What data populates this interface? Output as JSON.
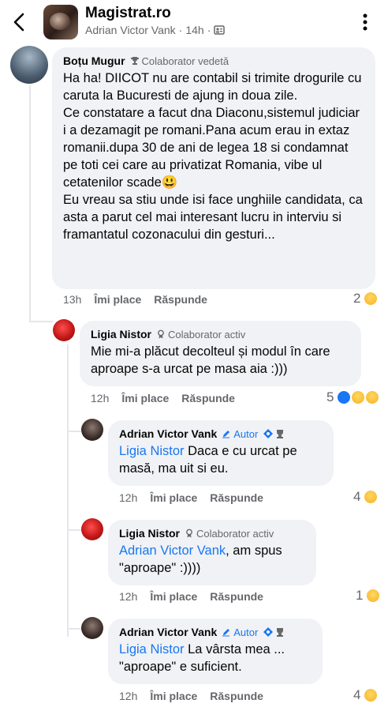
{
  "header": {
    "page_name": "Magistrat.ro",
    "author": "Adrian Victor Vank",
    "time": "14h",
    "separator": "·"
  },
  "comments": [
    {
      "author": "Boțu Mugur",
      "badge": "Colaborator vedetă",
      "text": "Ha ha! DIICOT nu are contabil si trimite drogurile cu caruta la Bucuresti de ajung in doua zile.\nCe constatare a facut dna Diaconu,sistemul judiciar i a dezamagit pe romani.Pana acum erau in extaz romanii.dupa 30 de ani de legea 18 si condamnat pe toti cei care au privatizat Romania, vibe ul cetatenilor scade😃\nEu vreau sa stiu unde isi face unghiile candidata, ca asta a parut cel mai interesant lucru in interviu si framantatul cozonacului din gesturi...",
      "time": "13h",
      "like_label": "Îmi place",
      "reply_label": "Răspunde",
      "reaction_count": "2"
    },
    {
      "author": "Ligia Nistor",
      "badge": "Colaborator activ",
      "text": "Mie mi-a plăcut decolteul și modul în care aproape s-a urcat pe masa aia :)))",
      "time": "12h",
      "like_label": "Îmi place",
      "reply_label": "Răspunde",
      "reaction_count": "5"
    },
    {
      "author": "Adrian Victor Vank",
      "badge": "Autor",
      "mention": "Ligia Nistor",
      "text": " Daca e cu urcat pe masă, ma uit si eu.",
      "time": "12h",
      "like_label": "Îmi place",
      "reply_label": "Răspunde",
      "reaction_count": "4"
    },
    {
      "author": "Ligia Nistor",
      "badge": "Colaborator activ",
      "mention": "Adrian Victor Vank",
      "text": ", am spus \"aproape\" :))))",
      "time": "12h",
      "like_label": "Îmi place",
      "reply_label": "Răspunde",
      "reaction_count": "1"
    },
    {
      "author": "Adrian Victor Vank",
      "badge": "Autor",
      "mention": "Ligia Nistor",
      "text": " La vârsta mea ... \"aproape\" e suficient.",
      "time": "12h",
      "like_label": "Îmi place",
      "reply_label": "Răspunde",
      "reaction_count": "4"
    }
  ],
  "icons": {
    "back": "chevron-left-icon",
    "more": "more-vertical-icon",
    "audience": "friends-icon",
    "badge_star": "trophy-icon",
    "badge_active": "medal-icon",
    "author_pen": "pencil-icon",
    "reactions": [
      "haha-emoji",
      "like-icon",
      "wow-emoji"
    ]
  },
  "colors": {
    "accent": "#1877f2",
    "bubble": "#f0f2f5",
    "meta": "#65676b"
  }
}
